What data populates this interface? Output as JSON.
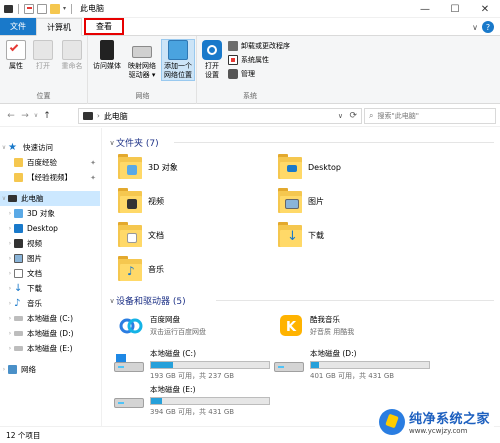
{
  "window": {
    "title": "此电脑",
    "controls": [
      "—",
      "☐",
      "✕"
    ]
  },
  "ribbon_tabs": [
    {
      "label": "文件"
    },
    {
      "label": "计算机"
    },
    {
      "label": "查看"
    }
  ],
  "ribbon": {
    "location_group": {
      "label": "位置",
      "buttons": [
        {
          "label": "属性",
          "icon": "checklist-icon"
        },
        {
          "label": "打开",
          "icon": "open-icon"
        },
        {
          "label": "重命名",
          "icon": "rename-icon"
        }
      ]
    },
    "network_group": {
      "label": "网络",
      "buttons": [
        {
          "label": "访问媒体",
          "icon": "media-icon"
        },
        {
          "label": "映射网络驱动器",
          "line1": "映射网络",
          "line2": "驱动器 ▾",
          "icon": "network-drive-icon"
        },
        {
          "label": "添加一个网络位置",
          "line1": "添加一个",
          "line2": "网络位置",
          "icon": "network-location-icon"
        }
      ]
    },
    "system_group": {
      "label": "系统",
      "open_settings": {
        "line1": "打开",
        "line2": "设置",
        "icon": "settings-icon"
      },
      "items": [
        {
          "label": "卸载或更改程序",
          "icon": "uninstall-icon"
        },
        {
          "label": "系统属性",
          "icon": "system-properties-icon"
        },
        {
          "label": "管理",
          "icon": "manage-icon"
        }
      ]
    }
  },
  "address_bar": {
    "path": "此电脑",
    "search_placeholder": "搜索\"此电脑\""
  },
  "nav_pane": {
    "items": [
      {
        "label": "快速访问",
        "icon": "star-icon",
        "level": 0
      },
      {
        "label": "百度经验",
        "icon": "folder-icon",
        "level": 1,
        "pinned": true
      },
      {
        "label": "【经验视频】",
        "icon": "folder-icon",
        "level": 1,
        "pinned": true
      },
      {
        "label": "此电脑",
        "icon": "computer-icon",
        "level": 0,
        "selected": true
      },
      {
        "label": "3D 对象",
        "icon": "3d-objects-icon",
        "level": 1
      },
      {
        "label": "Desktop",
        "icon": "desktop-icon",
        "level": 1
      },
      {
        "label": "视频",
        "icon": "video-icon",
        "level": 1
      },
      {
        "label": "图片",
        "icon": "pictures-icon",
        "level": 1
      },
      {
        "label": "文档",
        "icon": "documents-icon",
        "level": 1
      },
      {
        "label": "下载",
        "icon": "download-icon",
        "level": 1
      },
      {
        "label": "音乐",
        "icon": "music-icon",
        "level": 1
      },
      {
        "label": "本地磁盘 (C:)",
        "icon": "drive-icon",
        "level": 1
      },
      {
        "label": "本地磁盘 (D:)",
        "icon": "drive-icon",
        "level": 1
      },
      {
        "label": "本地磁盘 (E:)",
        "icon": "drive-icon",
        "level": 1
      },
      {
        "label": "网络",
        "icon": "network-icon",
        "level": 0
      }
    ]
  },
  "content": {
    "folders_header": "文件夹 (7)",
    "folders": [
      {
        "name": "3D 对象",
        "icon": "3d-objects-icon"
      },
      {
        "name": "Desktop",
        "icon": "desktop-icon"
      },
      {
        "name": "视频",
        "icon": "video-icon"
      },
      {
        "name": "图片",
        "icon": "pictures-icon"
      },
      {
        "name": "文档",
        "icon": "documents-icon"
      },
      {
        "name": "下载",
        "icon": "download-icon"
      },
      {
        "name": "音乐",
        "icon": "music-icon"
      }
    ],
    "devices_header": "设备和驱动器 (5)",
    "apps": [
      {
        "name": "百度网盘",
        "sub": "双击运行百度网盘",
        "icon": "baidu-netdisk-icon"
      },
      {
        "name": "酷我音乐",
        "sub": "好音质 用酷我",
        "icon": "kuwo-music-icon"
      }
    ],
    "drives": [
      {
        "name": "本地磁盘 (C:)",
        "free": "193 GB 可用，共 237 GB",
        "used_fraction": 0.19,
        "system": true
      },
      {
        "name": "本地磁盘 (D:)",
        "free": "401 GB 可用，共 431 GB",
        "used_fraction": 0.07,
        "system": false
      },
      {
        "name": "本地磁盘 (E:)",
        "free": "394 GB 可用，共 431 GB",
        "used_fraction": 0.09,
        "system": false
      }
    ]
  },
  "status_bar": {
    "count": "12 个项目"
  },
  "watermark": {
    "title": "纯净系统之家",
    "url": "www.ycwjzy.com"
  },
  "colors": {
    "accent": "#1979ca",
    "folder": "#ffd968",
    "drive_bar": "#26a0da",
    "selection": "#cce8ff",
    "highlight_box": "#e60000"
  }
}
